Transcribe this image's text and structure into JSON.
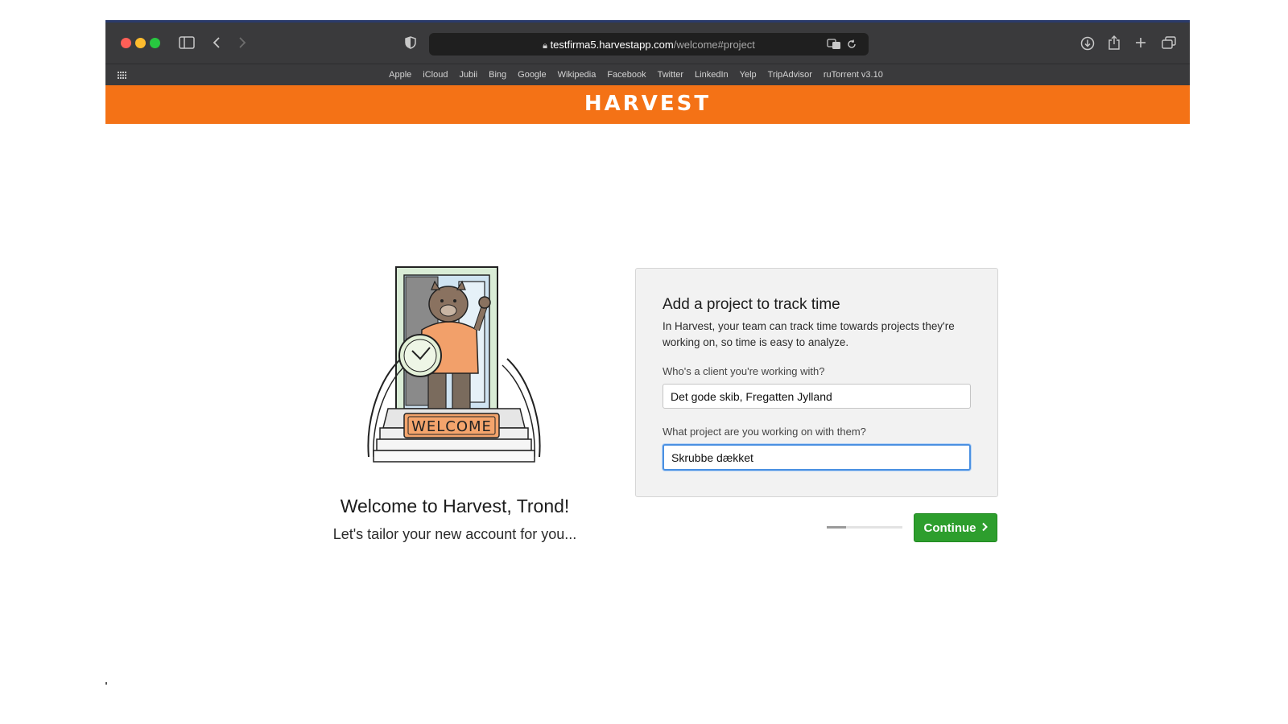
{
  "browser": {
    "url_host": "testfirma5.harvestapp.com",
    "url_path": "/welcome#project",
    "bookmarks": [
      "Apple",
      "iCloud",
      "Jubii",
      "Bing",
      "Google",
      "Wikipedia",
      "Facebook",
      "Twitter",
      "LinkedIn",
      "Yelp",
      "TripAdvisor",
      "ruTorrent v3.10"
    ]
  },
  "header": {
    "logo": "HARVEST",
    "brand_color": "#f47216"
  },
  "welcome": {
    "title": "Welcome to Harvest, Trond!",
    "subtitle": "Let's tailor your new account for you...",
    "mat_text": "WELCOME"
  },
  "card": {
    "title": "Add a project to track time",
    "description": "In Harvest, your team can track time towards projects they're working on, so time is easy to analyze.",
    "client_label": "Who's a client you're working with?",
    "client_value": "Det gode skib, Fregatten Jylland",
    "project_label": "What project are you working on with them?",
    "project_value": "Skrubbe dækket"
  },
  "footer": {
    "progress_fraction": 0.25,
    "continue_label": "Continue",
    "continue_color": "#2d9e2d"
  }
}
